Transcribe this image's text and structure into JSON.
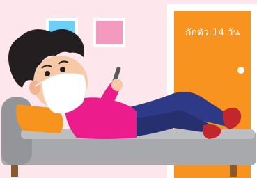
{
  "door": {
    "label": "กักตัว 14 วัน"
  },
  "colors": {
    "wall": "#fde6ec",
    "door": "#f7931e",
    "frame_left": "#6ecff6",
    "frame_right": "#f49ac1",
    "sofa": "#a7a9ac",
    "shirt": "#ec1c8c",
    "jeans": "#2e3a87",
    "pillow": "#f7941d"
  }
}
